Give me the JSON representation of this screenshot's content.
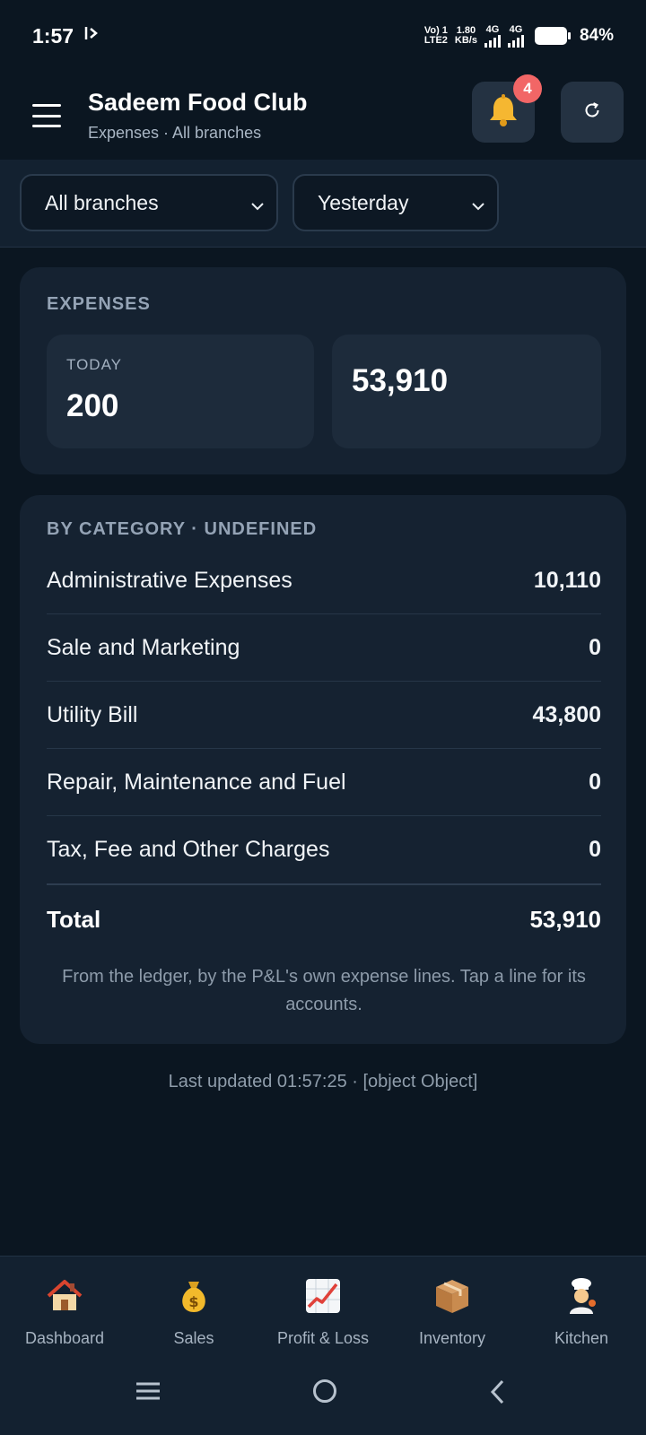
{
  "status_bar": {
    "time": "1:57",
    "network_left_top": "Vo) 1",
    "network_left_bottom": "LTE2",
    "speed_top": "1.80",
    "speed_bottom": "KB/s",
    "sim1_label": "4G",
    "sim2_label": "4G",
    "battery": "84%"
  },
  "header": {
    "title": "Sadeem Food Club",
    "subtitle": "Expenses · All branches",
    "notification_count": "4"
  },
  "filters": {
    "branch": "All branches",
    "period": "Yesterday"
  },
  "expenses_card": {
    "title": "EXPENSES",
    "today_label": "TODAY",
    "today_value": "200",
    "total_value": "53,910"
  },
  "category_card": {
    "title": "BY CATEGORY · UNDEFINED",
    "rows": [
      {
        "label": "Administrative Expenses",
        "amount": "10,110"
      },
      {
        "label": "Sale and Marketing",
        "amount": "0"
      },
      {
        "label": "Utility Bill",
        "amount": "43,800"
      },
      {
        "label": "Repair, Maintenance and Fuel",
        "amount": "0"
      },
      {
        "label": "Tax, Fee and Other Charges",
        "amount": "0"
      }
    ],
    "total_label": "Total",
    "total_amount": "53,910",
    "note": "From the ledger, by the P&L's own expense lines. Tap a line for its accounts."
  },
  "last_updated": "Last updated 01:57:25 · [object Object]",
  "bottom_nav": [
    {
      "label": "Dashboard",
      "icon": "house-icon"
    },
    {
      "label": "Sales",
      "icon": "money-bag-icon"
    },
    {
      "label": "Profit & Loss",
      "icon": "chart-increasing-icon"
    },
    {
      "label": "Inventory",
      "icon": "package-icon"
    },
    {
      "label": "Kitchen",
      "icon": "cook-icon"
    }
  ],
  "colors": {
    "background": "#0b1621",
    "card": "#152231",
    "badge": "#f26666",
    "bell": "#f5b731"
  }
}
